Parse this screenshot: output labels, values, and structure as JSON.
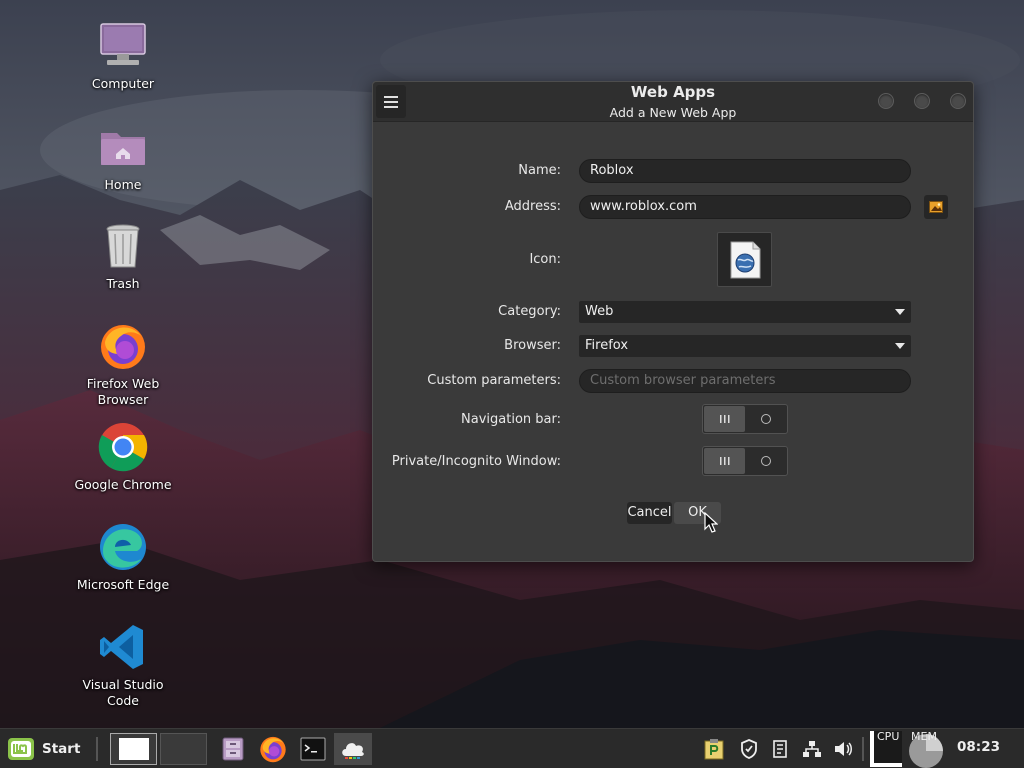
{
  "desktop": {
    "icons": [
      {
        "label": "Computer"
      },
      {
        "label": "Home"
      },
      {
        "label": "Trash"
      },
      {
        "label": "Firefox Web Browser"
      },
      {
        "label": "Google Chrome"
      },
      {
        "label": "Microsoft Edge"
      },
      {
        "label": "Visual Studio Code"
      }
    ]
  },
  "dialog": {
    "title": "Web Apps",
    "subtitle": "Add a New Web App",
    "fields": {
      "name_label": "Name:",
      "name_value": "Roblox",
      "address_label": "Address:",
      "address_value": "www.roblox.com",
      "icon_label": "Icon:",
      "category_label": "Category:",
      "category_value": "Web",
      "browser_label": "Browser:",
      "browser_value": "Firefox",
      "custom_label": "Custom parameters:",
      "custom_placeholder": "Custom browser parameters",
      "navbar_label": "Navigation bar:",
      "private_label": "Private/Incognito Window:"
    },
    "buttons": {
      "cancel": "Cancel",
      "ok": "OK"
    }
  },
  "taskbar": {
    "start_label": "Start",
    "cpu_label": "CPU",
    "mem_label": "MEM",
    "clock": "08:23"
  },
  "colors": {
    "accent_green": "#8bc34a",
    "dialog_bg": "#3a3a3a",
    "entry_bg": "#262626",
    "taskbar_bg": "#2a2a2a"
  }
}
